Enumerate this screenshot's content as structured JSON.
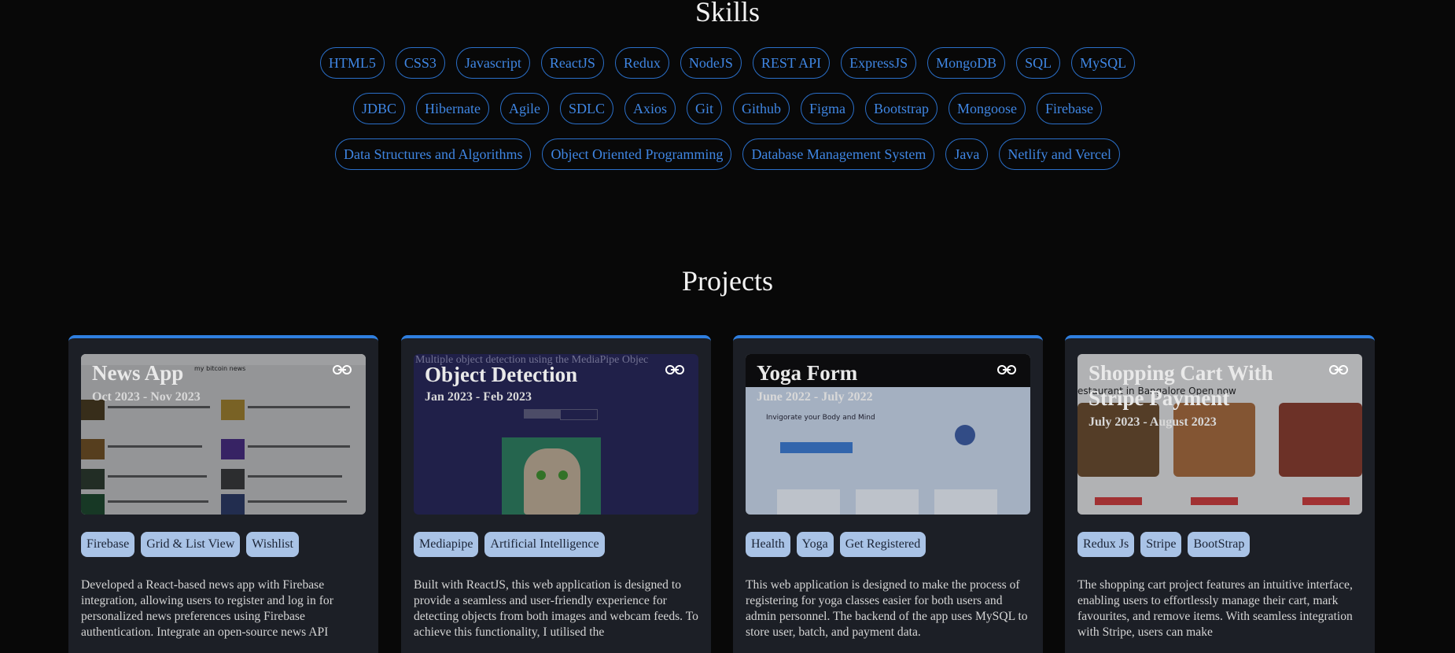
{
  "skills": {
    "title": "Skills",
    "row1": [
      "HTML5",
      "CSS3",
      "Javascript",
      "ReactJS",
      "Redux",
      "NodeJS",
      "REST API",
      "ExpressJS",
      "MongoDB",
      "SQL",
      "MySQL"
    ],
    "row2": [
      "JDBC",
      "Hibernate",
      "Agile",
      "SDLC",
      "Axios",
      "Git",
      "Github",
      "Figma",
      "Bootstrap",
      "Mongoose",
      "Firebase"
    ],
    "row3": [
      "Data Structures and Algorithms",
      "Object Oriented Programming",
      "Database Management System",
      "Java",
      "Netlify and Vercel"
    ]
  },
  "projects": {
    "title": "Projects",
    "cards": [
      {
        "title": "News App",
        "date": "Oct 2023 - Nov 2023",
        "thumb_heading": "my bitcoin news",
        "tags": [
          "Firebase",
          "Grid & List View",
          "Wishlist"
        ],
        "description": "Developed a React-based news app with Firebase integration, allowing users to register and log in for personalized news preferences using Firebase authentication. Integrate an open-source news API"
      },
      {
        "title": "Object Detection",
        "date": "Jan 2023 - Feb 2023",
        "thumb_heading": "Multiple object detection using the MediaPipe Objec",
        "tags": [
          "Mediapipe",
          "Artificial Intelligence"
        ],
        "description": "Built with ReactJS, this web application is designed to provide a seamless and user-friendly experience for detecting objects from both images and webcam feeds. To achieve this functionality, I utilised the"
      },
      {
        "title": "Yoga Form",
        "date": "June 2022 - July 2022",
        "thumb_heading": "Invigorate your Body and Mind",
        "tags": [
          "Health",
          "Yoga",
          "Get Registered"
        ],
        "description": "This web application is designed to make the process of registering for yoga classes easier for both users and admin personnel. The backend of the app uses MySQL to store user, batch, and payment data."
      },
      {
        "title": "Shopping Cart With Stripe Payment",
        "date": "July 2023 - August 2023",
        "thumb_heading": "estaurant in Bangalore Open now",
        "tags": [
          "Redux Js",
          "Stripe",
          "BootStrap"
        ],
        "description": "The shopping cart project features an intuitive interface, enabling users to effortlessly manage their cart, mark favourites, and remove items. With seamless integration with Stripe, users can make"
      }
    ]
  },
  "colors": {
    "accent": "#2f7fe0",
    "skill_text": "#3f86e3",
    "tag_bg": "#a9c3e6",
    "card_bg": "#1c1f26"
  },
  "icons": {
    "external_link": "link-icon"
  }
}
